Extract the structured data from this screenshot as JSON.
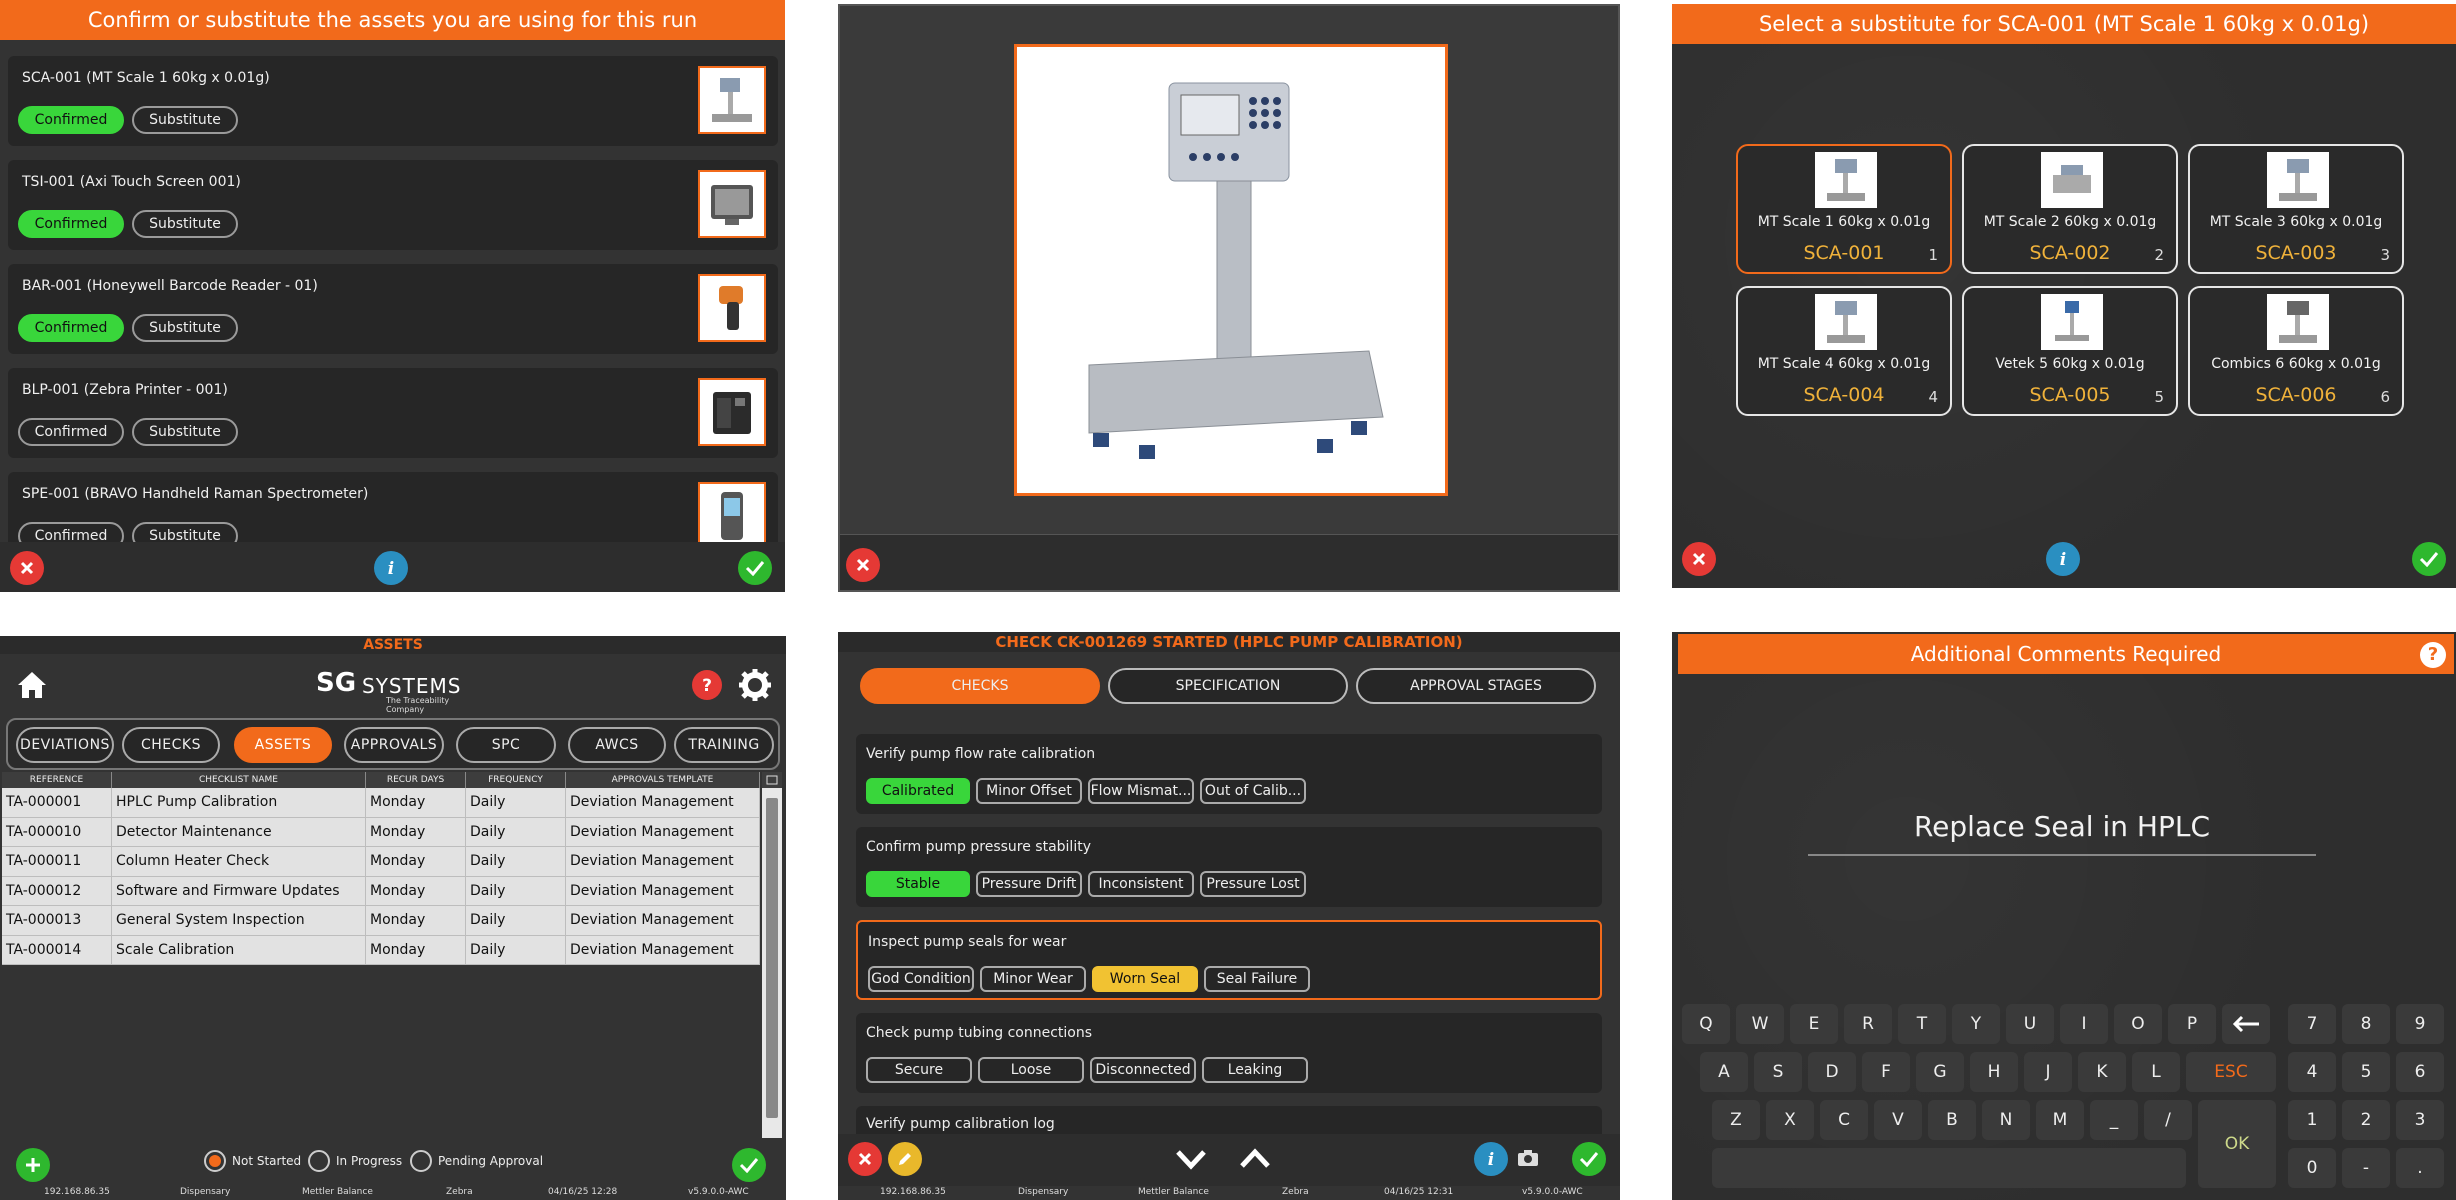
{
  "p1": {
    "header": "Confirm or substitute the assets you are using for this run",
    "confirm_label": "Confirmed",
    "substitute_label": "Substitute",
    "assets": [
      {
        "title": "SCA-001 (MT Scale 1 60kg x 0.01g)",
        "confirmed": true
      },
      {
        "title": "TSI-001 (Axi Touch Screen 001)",
        "confirmed": true
      },
      {
        "title": "BAR-001 (Honeywell Barcode Reader - 01)",
        "confirmed": true
      },
      {
        "title": "BLP-001 (Zebra Printer - 001)",
        "confirmed": false
      },
      {
        "title": "SPE-001 (BRAVO Handheld Raman Spectrometer)",
        "confirmed": false
      }
    ]
  },
  "p3": {
    "header": "Select a substitute for SCA-001 (MT Scale 1 60kg x 0.01g)",
    "options": [
      {
        "name": "MT Scale 1 60kg x 0.01g",
        "code": "SCA-001",
        "index": "1"
      },
      {
        "name": "MT Scale 2 60kg x 0.01g",
        "code": "SCA-002",
        "index": "2"
      },
      {
        "name": "MT Scale 3 60kg x 0.01g",
        "code": "SCA-003",
        "index": "3"
      },
      {
        "name": "MT Scale 4 60kg x 0.01g",
        "code": "SCA-004",
        "index": "4"
      },
      {
        "name": "Vetek 5 60kg x 0.01g",
        "code": "SCA-005",
        "index": "5"
      },
      {
        "name": "Combics 6 60kg x 0.01g",
        "code": "SCA-006",
        "index": "6"
      }
    ]
  },
  "p4": {
    "title": "ASSETS",
    "logo_main": "SG",
    "logo_systems": "SYSTEMS",
    "logo_tagline": "The Traceability Company",
    "tabs": [
      "DEVIATIONS",
      "CHECKS",
      "ASSETS",
      "APPROVALS",
      "SPC",
      "AWCS",
      "TRAINING"
    ],
    "columns": [
      "REFERENCE",
      "CHECKLIST NAME",
      "RECUR DAYS",
      "FREQUENCY",
      "APPROVALS TEMPLATE"
    ],
    "rows": [
      [
        "TA-000001",
        "HPLC Pump Calibration",
        "Monday",
        "Daily",
        "Deviation Management"
      ],
      [
        "TA-000010",
        "Detector Maintenance",
        "Monday",
        "Daily",
        "Deviation Management"
      ],
      [
        "TA-000011",
        "Column Heater Check",
        "Monday",
        "Daily",
        "Deviation Management"
      ],
      [
        "TA-000012",
        "Software and Firmware Updates",
        "Monday",
        "Daily",
        "Deviation Management"
      ],
      [
        "TA-000013",
        "General System Inspection",
        "Monday",
        "Daily",
        "Deviation Management"
      ],
      [
        "TA-000014",
        "Scale Calibration",
        "Monday",
        "Daily",
        "Deviation Management"
      ]
    ],
    "filters": [
      {
        "label": "Not Started",
        "selected": true
      },
      {
        "label": "In Progress",
        "selected": false
      },
      {
        "label": "Pending Approval",
        "selected": false
      }
    ],
    "status": [
      "192.168.86.35",
      "Dispensary",
      "Mettler Balance",
      "Zebra",
      "04/16/25 12:28",
      "v5.9.0.0-AWC"
    ]
  },
  "p5": {
    "title": "CHECK CK-001269 STARTED (HPLC PUMP CALIBRATION)",
    "tabs": [
      "CHECKS",
      "SPECIFICATION",
      "APPROVAL STAGES"
    ],
    "checks": [
      {
        "question": "Verify pump flow rate calibration",
        "options": [
          "Calibrated",
          "Minor Offset",
          "Flow Mismat...",
          "Out of Calib..."
        ]
      },
      {
        "question": "Confirm pump pressure stability",
        "options": [
          "Stable",
          "Pressure Drift",
          "Inconsistent",
          "Pressure Lost"
        ]
      },
      {
        "question": "Inspect pump seals for wear",
        "options": [
          "God Condition",
          "Minor Wear",
          "Worn Seal",
          "Seal Failure"
        ]
      },
      {
        "question": "Check pump tubing connections",
        "options": [
          "Secure",
          "Loose",
          "Disconnected",
          "Leaking"
        ]
      },
      {
        "question": "Verify pump calibration log",
        "options": []
      }
    ],
    "status": [
      "192.168.86.35",
      "Dispensary",
      "Mettler Balance",
      "Zebra",
      "04/16/25 12:31",
      "v5.9.0.0-AWC"
    ]
  },
  "p6": {
    "header": "Additional Comments Required",
    "help": "?",
    "comment": "Replace Seal in HPLC",
    "row1": [
      "Q",
      "W",
      "E",
      "R",
      "T",
      "Y",
      "U",
      "I",
      "O",
      "P"
    ],
    "row2": [
      "A",
      "S",
      "D",
      "F",
      "G",
      "H",
      "J",
      "K",
      "L"
    ],
    "row3": [
      "Z",
      "X",
      "C",
      "V",
      "B",
      "N",
      "M",
      "_",
      "/"
    ],
    "esc": "ESC",
    "ok": "OK",
    "numpad": [
      "7",
      "8",
      "9",
      "4",
      "5",
      "6",
      "1",
      "2",
      "3",
      "0",
      "-",
      "."
    ]
  },
  "colors": {
    "accent": "#f26a1b",
    "green": "#39d63b",
    "yellow": "#f1c232",
    "code": "#f0b23a"
  }
}
